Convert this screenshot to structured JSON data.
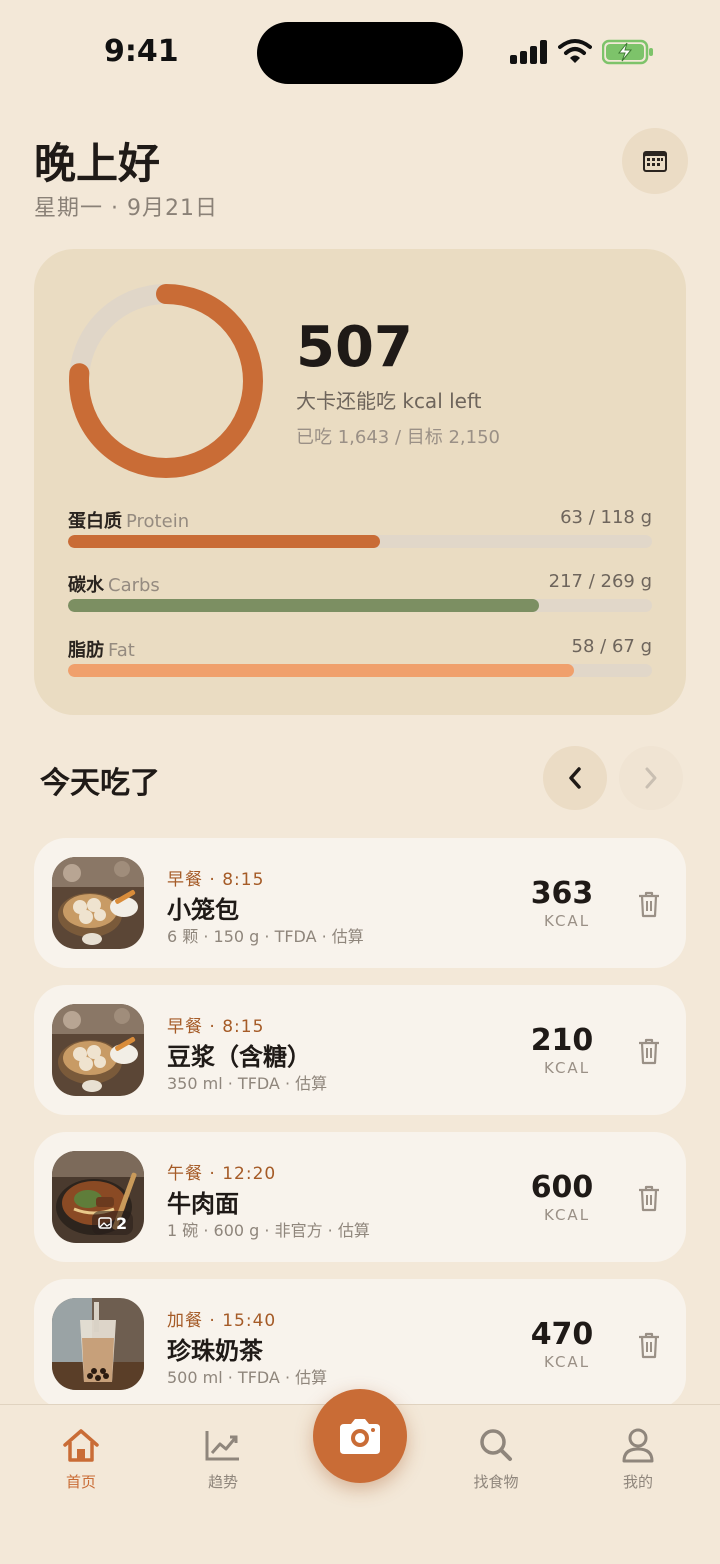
{
  "status_bar": {
    "time": "9:41"
  },
  "header": {
    "greeting": "晚上好",
    "date": "星期一 · 9月21日"
  },
  "summary": {
    "kcal_left": "507",
    "kcal_left_label": "大卡还能吃 kcal left",
    "consumed_text": "已吃 1,643 / 目标 2,150",
    "progress_fraction": 0.764,
    "accent_color": "#c96c36",
    "macros": [
      {
        "name": "蛋白质",
        "name_en": "Protein",
        "value": "63 / 118 g",
        "fraction": 0.534,
        "color": "#c96c36"
      },
      {
        "name": "碳水",
        "name_en": "Carbs",
        "value": "217 / 269 g",
        "fraction": 0.807,
        "color": "#7c8f62"
      },
      {
        "name": "脂肪",
        "name_en": "Fat",
        "value": "58 / 67 g",
        "fraction": 0.866,
        "color": "#f0a06c"
      }
    ]
  },
  "section": {
    "title": "今天吃了"
  },
  "foods": [
    {
      "meal": "早餐 · 8:15",
      "name": "小笼包",
      "detail": "6 颗 · 150 g · TFDA · 估算",
      "kcal": "363",
      "unit": "KCAL",
      "photo": "dumplings"
    },
    {
      "meal": "早餐 · 8:15",
      "name": "豆浆（含糖）",
      "detail": "350 ml · TFDA · 估算",
      "kcal": "210",
      "unit": "KCAL",
      "photo": "dumplings"
    },
    {
      "meal": "午餐 · 12:20",
      "name": "牛肉面",
      "detail": "1 碗 · 600 g · 非官方 · 估算",
      "kcal": "600",
      "unit": "KCAL",
      "photo": "beef-noodle",
      "photo_count": "2"
    },
    {
      "meal": "加餐 · 15:40",
      "name": "珍珠奶茶",
      "detail": "500 ml · TFDA · 估算",
      "kcal": "470",
      "unit": "KCAL",
      "photo": "milk-tea"
    }
  ],
  "tabs": [
    {
      "label": "首页",
      "icon": "home-icon",
      "active": true
    },
    {
      "label": "趋势",
      "icon": "trend-chart-icon",
      "active": false
    },
    {
      "label": "找食物",
      "icon": "search-icon",
      "active": false
    },
    {
      "label": "我的",
      "icon": "profile-icon",
      "active": false
    }
  ],
  "camera": {
    "icon": "camera-icon"
  }
}
